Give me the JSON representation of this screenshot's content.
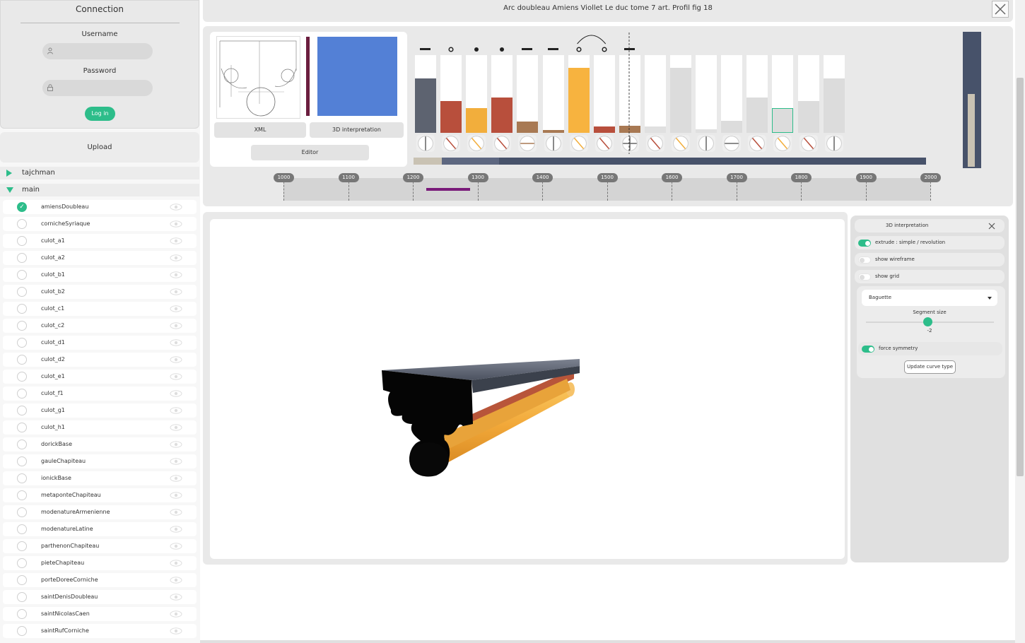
{
  "connection": {
    "title": "Connection",
    "username_label": "Username",
    "username_value": "",
    "password_label": "Password",
    "password_value": "",
    "login_label": "Log in"
  },
  "upload_label": "Upload",
  "folders": [
    {
      "label": "tajchman",
      "expanded": false
    },
    {
      "label": "main",
      "expanded": true
    }
  ],
  "files": [
    {
      "name": "amiensDoubleau",
      "checked": true
    },
    {
      "name": "cornicheSyriaque",
      "checked": false
    },
    {
      "name": "culot_a1",
      "checked": false
    },
    {
      "name": "culot_a2",
      "checked": false
    },
    {
      "name": "culot_b1",
      "checked": false
    },
    {
      "name": "culot_b2",
      "checked": false
    },
    {
      "name": "culot_c1",
      "checked": false
    },
    {
      "name": "culot_c2",
      "checked": false
    },
    {
      "name": "culot_d1",
      "checked": false
    },
    {
      "name": "culot_d2",
      "checked": false
    },
    {
      "name": "culot_e1",
      "checked": false
    },
    {
      "name": "culot_f1",
      "checked": false
    },
    {
      "name": "culot_g1",
      "checked": false
    },
    {
      "name": "culot_h1",
      "checked": false
    },
    {
      "name": "dorickBase",
      "checked": false
    },
    {
      "name": "gauleChapiteau",
      "checked": false
    },
    {
      "name": "ionickBase",
      "checked": false
    },
    {
      "name": "metaponteChapiteau",
      "checked": false
    },
    {
      "name": "modenatureArmenienne",
      "checked": false
    },
    {
      "name": "modenatureLatine",
      "checked": false
    },
    {
      "name": "parthenonChapiteau",
      "checked": false
    },
    {
      "name": "pieteChapiteau",
      "checked": false
    },
    {
      "name": "porteDoreeCorniche",
      "checked": false
    },
    {
      "name": "saintDenisDoubleau",
      "checked": false
    },
    {
      "name": "saintNicolasCaen",
      "checked": false
    },
    {
      "name": "saintRufCorniche",
      "checked": false
    }
  ],
  "header": {
    "title": "Arc doubleau Amiens Viollet Le duc tome 7 art. Profil fig 18"
  },
  "profile": {
    "xml_label": "XML",
    "interp_label": "3D interpretation",
    "editor_label": "Editor",
    "segments": [
      {
        "symbol": "dash",
        "fill": 0.84,
        "color": "#5d6370",
        "curve_icon": "vertical-line-icon",
        "curve_color": "#666"
      },
      {
        "symbol": "ring",
        "fill": 0.49,
        "color": "#b84f3c",
        "curve_icon": "diagonal-line-icon",
        "curve_color": "#b84f3c"
      },
      {
        "symbol": "dot",
        "fill": 0.38,
        "color": "#f2ae3c",
        "curve_icon": "diagonal-line-icon",
        "curve_color": "#f2ae3c"
      },
      {
        "symbol": "dot",
        "fill": 0.54,
        "color": "#b84f3c",
        "curve_icon": "diagonal-line-icon",
        "curve_color": "#b84f3c"
      },
      {
        "symbol": "dash",
        "fill": 0.17,
        "color": "#a87953",
        "curve_icon": "horizontal-line-icon",
        "curve_color": "#a87953"
      },
      {
        "symbol": "dash",
        "fill": 0.04,
        "color": "#a87953",
        "curve_icon": "vertical-line-icon",
        "curve_color": "#666"
      },
      {
        "symbol": "ring",
        "fill": 1.0,
        "color": "#f7b33f",
        "curve_icon": "diagonal-line-icon",
        "curve_color": "#f2ae3c"
      },
      {
        "symbol": "ring",
        "fill": 0.1,
        "color": "#b84f3c",
        "curve_icon": "diagonal-line-icon",
        "curve_color": "#b84f3c"
      },
      {
        "symbol": "dash",
        "fill": 0.11,
        "color": "#a87953",
        "curve_icon": "cross-line-icon",
        "curve_color": "#666"
      },
      {
        "symbol": "none",
        "fill": 0.1,
        "color": "#e0e0e0",
        "curve_icon": "diagonal-line-icon",
        "curve_color": "#b84f3c"
      },
      {
        "symbol": "none",
        "fill": 1.0,
        "color": "#dcdcdc",
        "curve_icon": "diagonal-line-icon",
        "curve_color": "#f2ae3c"
      },
      {
        "symbol": "none",
        "fill": 0.05,
        "color": "#e0e0e0",
        "curve_icon": "vertical-line-icon",
        "curve_color": "#666"
      },
      {
        "symbol": "none",
        "fill": 0.18,
        "color": "#dcdcdc",
        "curve_icon": "horizontal-line-icon",
        "curve_color": "#666"
      },
      {
        "symbol": "none",
        "fill": 0.54,
        "color": "#dcdcdc",
        "curve_icon": "diagonal-line-icon",
        "curve_color": "#b84f3c"
      },
      {
        "symbol": "none",
        "fill": 0.38,
        "color": "#dcdcdc",
        "curve_icon": "diagonal-line-icon",
        "curve_color": "#f2ae3c",
        "outlined": true
      },
      {
        "symbol": "none",
        "fill": 0.49,
        "color": "#dcdcdc",
        "curve_icon": "diagonal-line-icon",
        "curve_color": "#b84f3c"
      },
      {
        "symbol": "none",
        "fill": 0.84,
        "color": "#dcdcdc",
        "curve_icon": "vertical-line-icon",
        "curve_color": "#666"
      }
    ]
  },
  "timeline": {
    "labels": [
      "1000",
      "1100",
      "1200",
      "1300",
      "1400",
      "1500",
      "1600",
      "1700",
      "1800",
      "1900",
      "2000"
    ],
    "range_start": 1220,
    "range_end": 1290,
    "range_color": "#7a1b7a"
  },
  "side_panel": {
    "title": "3D interpretation",
    "options": [
      {
        "label": "extrude : simple / revolution",
        "on": true
      },
      {
        "label": "show wireframe",
        "on": false
      },
      {
        "label": "show grid",
        "on": false
      }
    ],
    "curve_type": "Baguette",
    "segment_size_label": "Segment size",
    "segment_size_value": "-2",
    "force_symmetry_label": "force symmetry",
    "force_symmetry_on": true,
    "update_label": "Update curve type"
  },
  "colors": {
    "accent": "#2dbd8a",
    "panel": "#e9e9e9",
    "dark_slate": "#47526a",
    "blue_preview": "#5380d6"
  }
}
